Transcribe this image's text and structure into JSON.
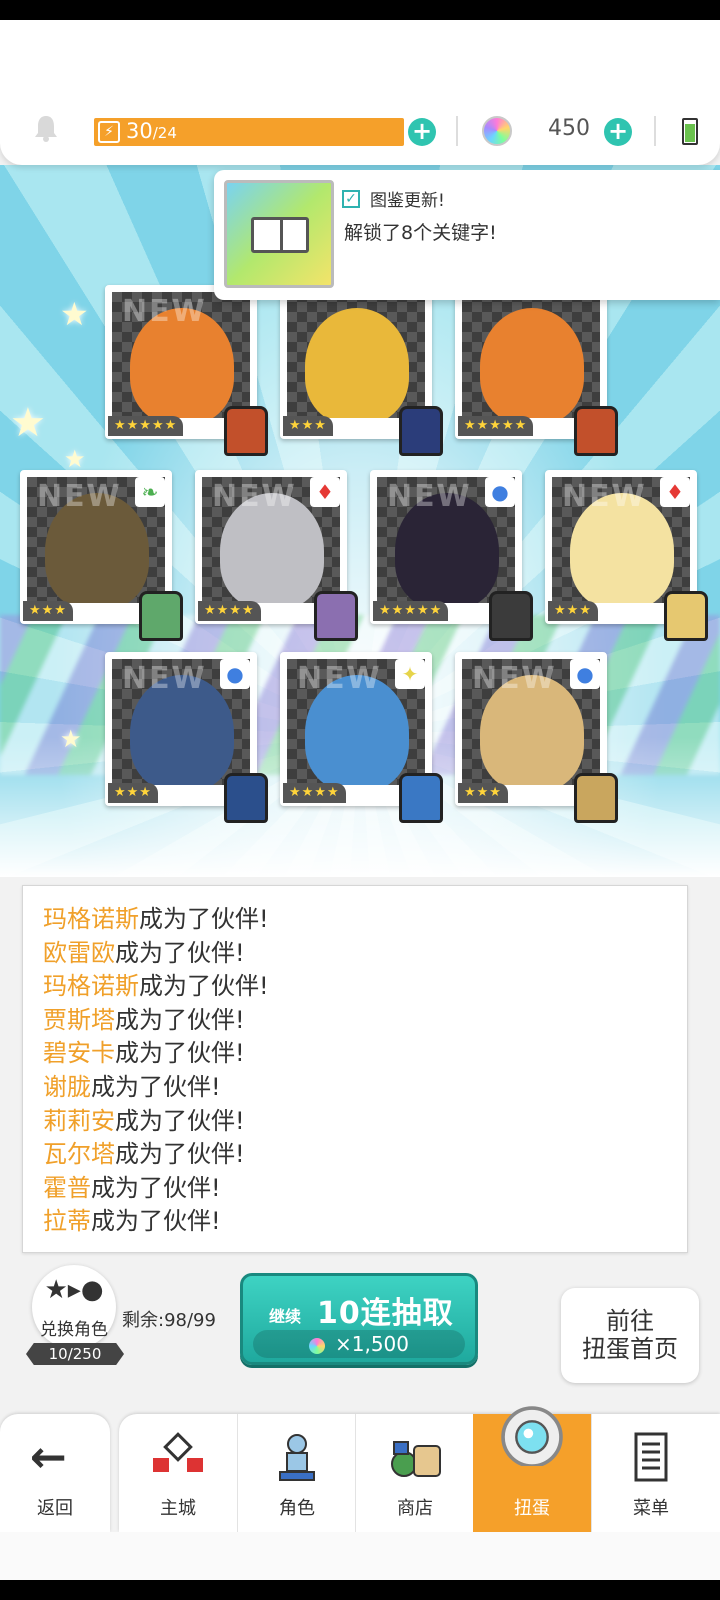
{
  "status": {
    "energy_current": "30",
    "energy_max": "/24",
    "gems": "450"
  },
  "notification": {
    "title": "图鉴更新!",
    "body": "解锁了8个关键字!"
  },
  "cards": [
    {
      "stars": "★★★★★",
      "element": "",
      "new": "NEW",
      "color": "#e8812f",
      "sprite": "#c2502b"
    },
    {
      "stars": "★★★",
      "element": "",
      "new": "",
      "color": "#e9b83a",
      "sprite": "#2b3d7a"
    },
    {
      "stars": "★★★★★",
      "element": "",
      "new": "",
      "color": "#e8812f",
      "sprite": "#c2502b"
    },
    {
      "stars": "★★★",
      "element": "leaf",
      "new": "NEW",
      "color": "#6b5a3a",
      "sprite": "#5fa86b"
    },
    {
      "stars": "★★★★",
      "element": "diamond",
      "new": "NEW",
      "color": "#bfbfc4",
      "sprite": "#8b6fb0"
    },
    {
      "stars": "★★★★★",
      "element": "circle",
      "new": "NEW",
      "color": "#2a2436",
      "sprite": "#3b3b3b"
    },
    {
      "stars": "★★★",
      "element": "diamond",
      "new": "NEW",
      "color": "#f4e2a1",
      "sprite": "#e6c870"
    },
    {
      "stars": "★★★",
      "element": "circle",
      "new": "NEW",
      "color": "#3d5a8a",
      "sprite": "#2b4f8c"
    },
    {
      "stars": "★★★★",
      "element": "spark",
      "new": "NEW",
      "color": "#4a8fd0",
      "sprite": "#3a78c4"
    },
    {
      "stars": "★★★",
      "element": "circle",
      "new": "NEW",
      "color": "#d9b77a",
      "sprite": "#c9a65e"
    }
  ],
  "log": [
    {
      "name": "玛格诺斯",
      "suffix": "成为了伙伴!"
    },
    {
      "name": "欧雷欧",
      "suffix": "成为了伙伴!"
    },
    {
      "name": "玛格诺斯",
      "suffix": "成为了伙伴!"
    },
    {
      "name": "贾斯塔",
      "suffix": "成为了伙伴!"
    },
    {
      "name": "碧安卡",
      "suffix": "成为了伙伴!"
    },
    {
      "name": "谢胧",
      "suffix": "成为了伙伴!"
    },
    {
      "name": "莉莉安",
      "suffix": "成为了伙伴!"
    },
    {
      "name": "瓦尔塔",
      "suffix": "成为了伙伴!"
    },
    {
      "name": "霍普",
      "suffix": "成为了伙伴!"
    },
    {
      "name": "拉蒂",
      "suffix": "成为了伙伴!"
    }
  ],
  "actions": {
    "swap_label": "兑换角色",
    "swap_count": "10/250",
    "remain": "剩余:98/99",
    "pull_continue": "继续",
    "pull_title": "10连抽取",
    "pull_cost": "×1,500",
    "goto_line1": "前往",
    "goto_line2": "扭蛋首页"
  },
  "nav": {
    "back": "返回",
    "tabs": [
      "主城",
      "角色",
      "商店",
      "扭蛋",
      "菜单"
    ],
    "active": "扭蛋"
  },
  "colors": {
    "accent_orange": "#f5a02a",
    "accent_teal": "#2fc4b0",
    "name_highlight": "#f0a02a"
  }
}
